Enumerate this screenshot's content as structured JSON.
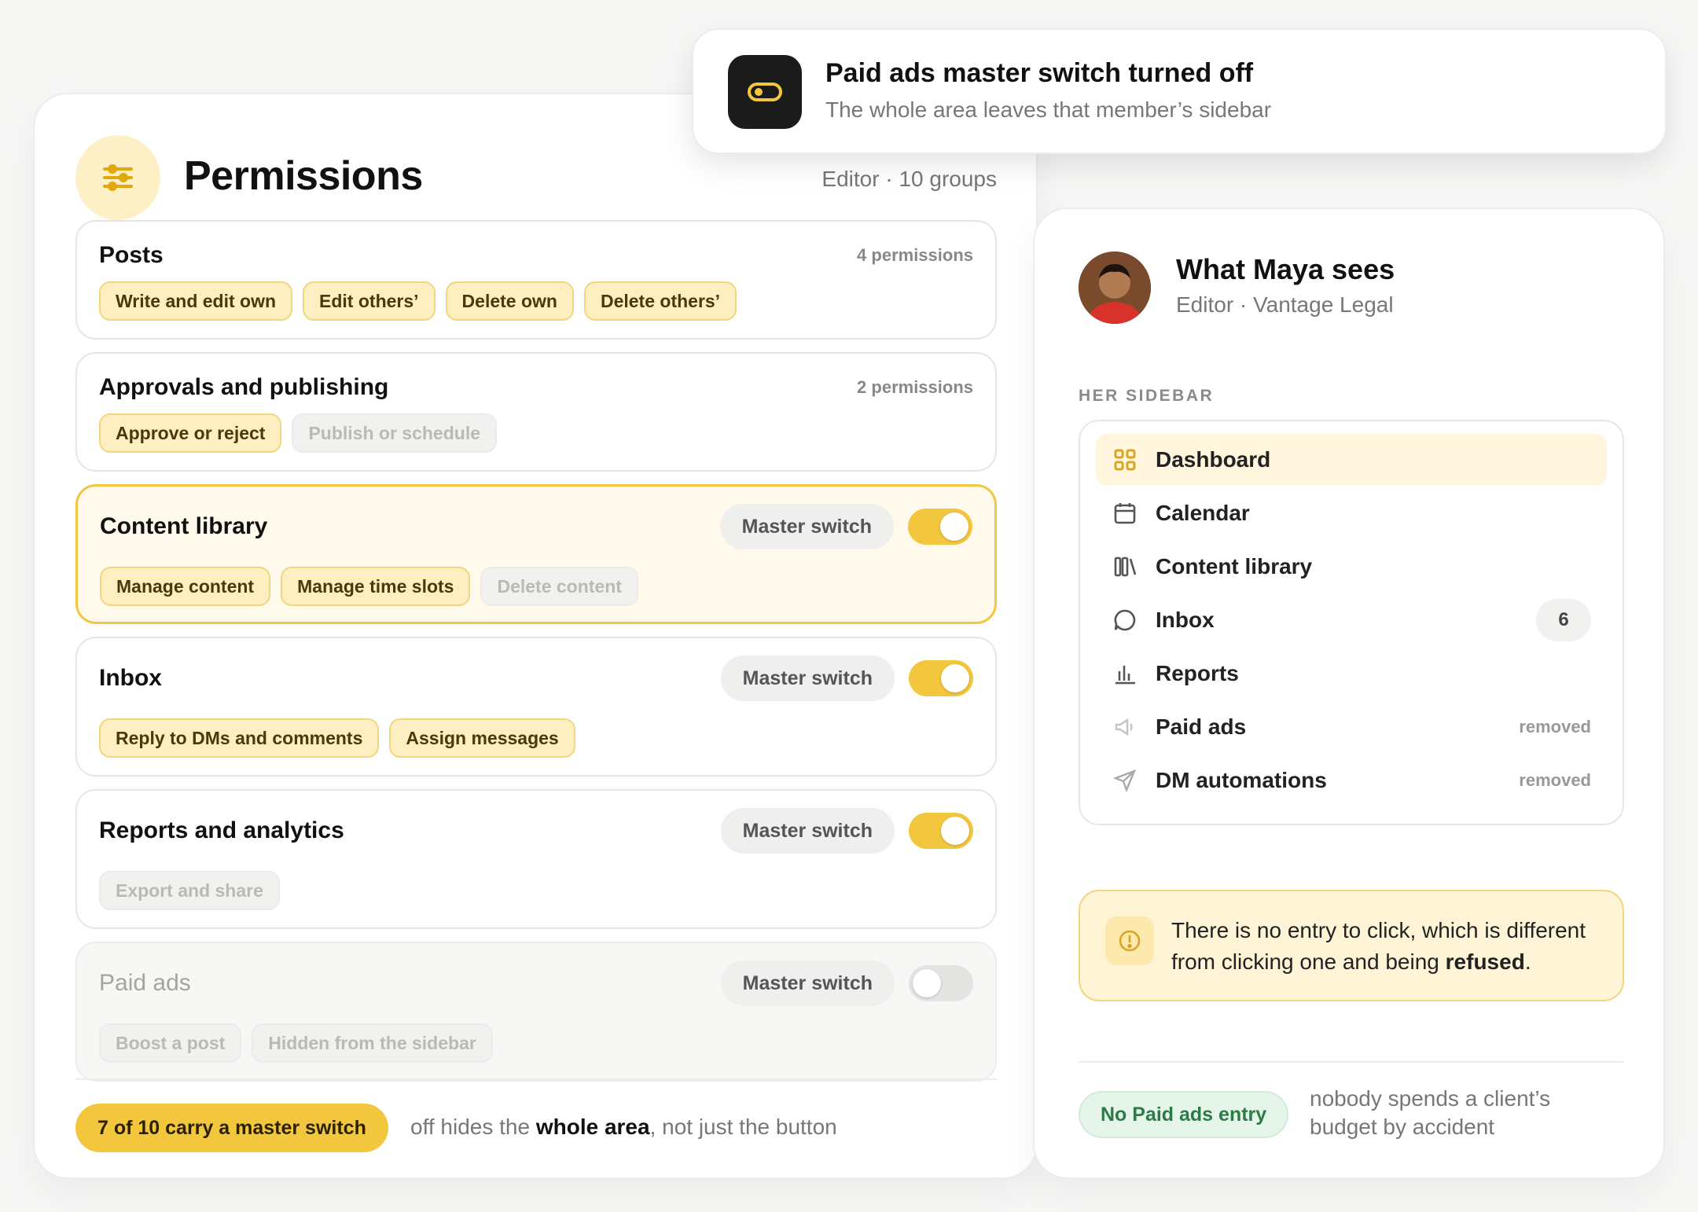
{
  "toast": {
    "title": "Paid ads master switch turned off",
    "subtitle": "The whole area leaves that member’s sidebar",
    "icon": "toggle-icon"
  },
  "permissions": {
    "title": "Permissions",
    "subtitle": "Editor · 10 groups",
    "groups": [
      {
        "name": "Posts",
        "count": "4 permissions",
        "chips": [
          {
            "label": "Write and edit own",
            "on": true
          },
          {
            "label": "Edit others’",
            "on": true
          },
          {
            "label": "Delete own",
            "on": true
          },
          {
            "label": "Delete others’",
            "on": true
          }
        ]
      },
      {
        "name": "Approvals and publishing",
        "count": "2 permissions",
        "chips": [
          {
            "label": "Approve or reject",
            "on": true
          },
          {
            "label": "Publish or schedule",
            "on": false
          }
        ]
      },
      {
        "name": "Content library",
        "master": "Master switch",
        "switch_on": true,
        "chips": [
          {
            "label": "Manage content",
            "on": true
          },
          {
            "label": "Manage time slots",
            "on": true
          },
          {
            "label": "Delete content",
            "on": false
          }
        ]
      },
      {
        "name": "Inbox",
        "master": "Master switch",
        "switch_on": true,
        "chips": [
          {
            "label": "Reply to DMs and comments",
            "on": true
          },
          {
            "label": "Assign messages",
            "on": true
          }
        ]
      },
      {
        "name": "Reports and analytics",
        "master": "Master switch",
        "switch_on": true,
        "chips": [
          {
            "label": "Export and share",
            "on": false
          }
        ]
      },
      {
        "name": "Paid ads",
        "master": "Master switch",
        "switch_on": false,
        "chips": [
          {
            "label": "Boost a post",
            "on": false
          },
          {
            "label": "Hidden from the sidebar",
            "on": false
          }
        ]
      }
    ],
    "footer_pill": "7 of 10 carry a master switch",
    "footer_text_pre": "off hides the ",
    "footer_text_bold": "whole area",
    "footer_text_post": ", not just the button"
  },
  "maya": {
    "title": "What Maya sees",
    "subtitle": "Editor · Vantage Legal",
    "section_label": "HER SIDEBAR",
    "sidebar": [
      {
        "label": "Dashboard",
        "icon": "grid-icon",
        "active": true
      },
      {
        "label": "Calendar",
        "icon": "calendar-icon"
      },
      {
        "label": "Content library",
        "icon": "library-icon"
      },
      {
        "label": "Inbox",
        "icon": "chat-icon",
        "badge": "6"
      },
      {
        "label": "Reports",
        "icon": "bar-chart-icon"
      },
      {
        "label": "Paid ads",
        "icon": "megaphone-icon",
        "status": "removed"
      },
      {
        "label": "DM automations",
        "icon": "send-icon",
        "status": "removed"
      }
    ],
    "note_pre": "There is no entry to click, which is different from clicking one and being ",
    "note_bold": "refused",
    "note_post": ".",
    "green_pill": "No Paid ads entry",
    "green_text": "nobody spends a client’s budget by accident"
  },
  "colors": {
    "accent": "#f3c73d",
    "accent_soft": "#fdefc2",
    "green": "#2c7a45"
  }
}
